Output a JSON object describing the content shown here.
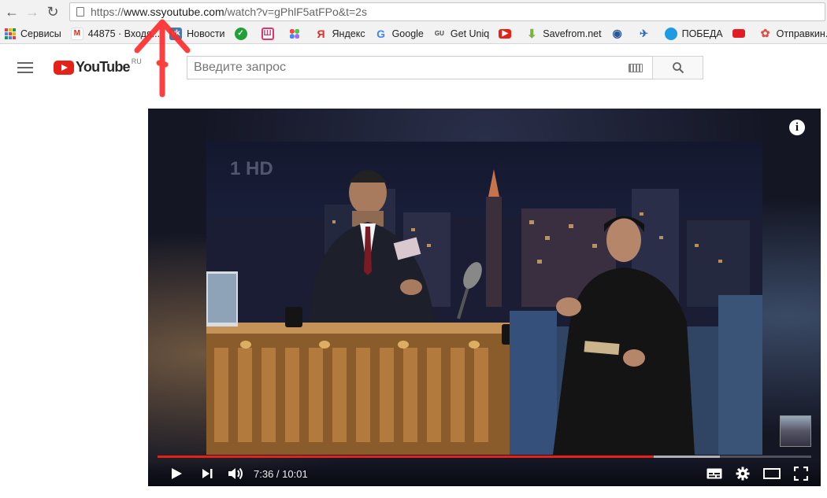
{
  "browser": {
    "url_scheme": "https://",
    "url_host": "www.ssyoutube.com",
    "url_path": "/watch?v=gPhlF5atFPo&t=2s"
  },
  "bookmarks": [
    {
      "label": "Сервисы",
      "icon": "apps-icon"
    },
    {
      "label": "44875 · Входя...",
      "icon": "gmail-icon",
      "color": "#d93025"
    },
    {
      "label": "Новости",
      "icon": "vk-icon",
      "color": "#4a76a8"
    },
    {
      "label": "",
      "icon": "sber-icon",
      "color": "#21a038"
    },
    {
      "label": "",
      "icon": "pink-logo-icon",
      "color": "#e3336f"
    },
    {
      "label": "",
      "icon": "colored-dots-icon",
      "color": "#7b68ee"
    },
    {
      "label": "Яндекс",
      "icon": "yandex-icon",
      "color": "#e32b2b"
    },
    {
      "label": "Google",
      "icon": "google-icon",
      "color": "#4285f4"
    },
    {
      "label": "Get Uniq",
      "icon": "getuniq-icon",
      "color": "#444444"
    },
    {
      "label": "",
      "icon": "youtube-icon",
      "color": "#e62117"
    },
    {
      "label": "Savefrom.net",
      "icon": "download-arrow-icon",
      "color": "#7cb342"
    },
    {
      "label": "",
      "icon": "eye-icon",
      "color": "#2b5797"
    },
    {
      "label": "",
      "icon": "bird-icon",
      "color": "#2f6db5"
    },
    {
      "label": "ПОБЕДА",
      "icon": "pobeda-icon",
      "color": "#1e9be3"
    },
    {
      "label": "",
      "icon": "red-badge-icon",
      "color": "#e31b23"
    },
    {
      "label": "Отправкин.ру",
      "icon": "otpravkin-icon",
      "color": "#d9534f"
    }
  ],
  "youtube": {
    "logo_text": "YouTube",
    "region": "RU",
    "search_placeholder": "Введите запрос"
  },
  "player": {
    "current_time": "7:36",
    "duration": "10:01",
    "time_display": "7:36 / 10:01",
    "played_fraction": 0.759,
    "buffered_fraction": 0.86,
    "info_glyph": "i"
  },
  "colors": {
    "youtube_red": "#e62117",
    "annotation_red": "#ff2a2a"
  }
}
